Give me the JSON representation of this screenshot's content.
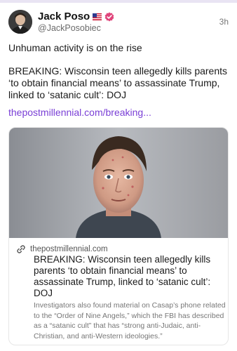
{
  "post": {
    "author_name": "Jack Poso",
    "author_handle": "@JackPosobiec",
    "timestamp": "3h",
    "text_line1": "Unhuman activity is on the rise",
    "text_line2": "BREAKING: Wisconsin teen allegedly kills parents ‘to obtain financial means’ to assassinate Trump, linked to ‘satanic cult’: DOJ",
    "link_text": "thepostmillennial.com/breaking..."
  },
  "card": {
    "domain": "thepostmillennial.com",
    "title": "BREAKING: Wisconsin teen allegedly kills parents ‘to obtain financial means’ to assassinate Trump, linked to ‘satanic cult’: DOJ",
    "description": "Investigators also found material on Casap’s phone related to the “Order of Nine Angels,” which the FBI has described as a “satanic cult” that has “strong anti-Judaic, anti-Christian, and anti-Western ideologies.”"
  },
  "icons": {
    "flag": "us-flag-icon",
    "verified": "verified-badge-icon",
    "link": "link-icon"
  },
  "colors": {
    "accent": "#7a3fd6",
    "verified": "#e0457b"
  }
}
